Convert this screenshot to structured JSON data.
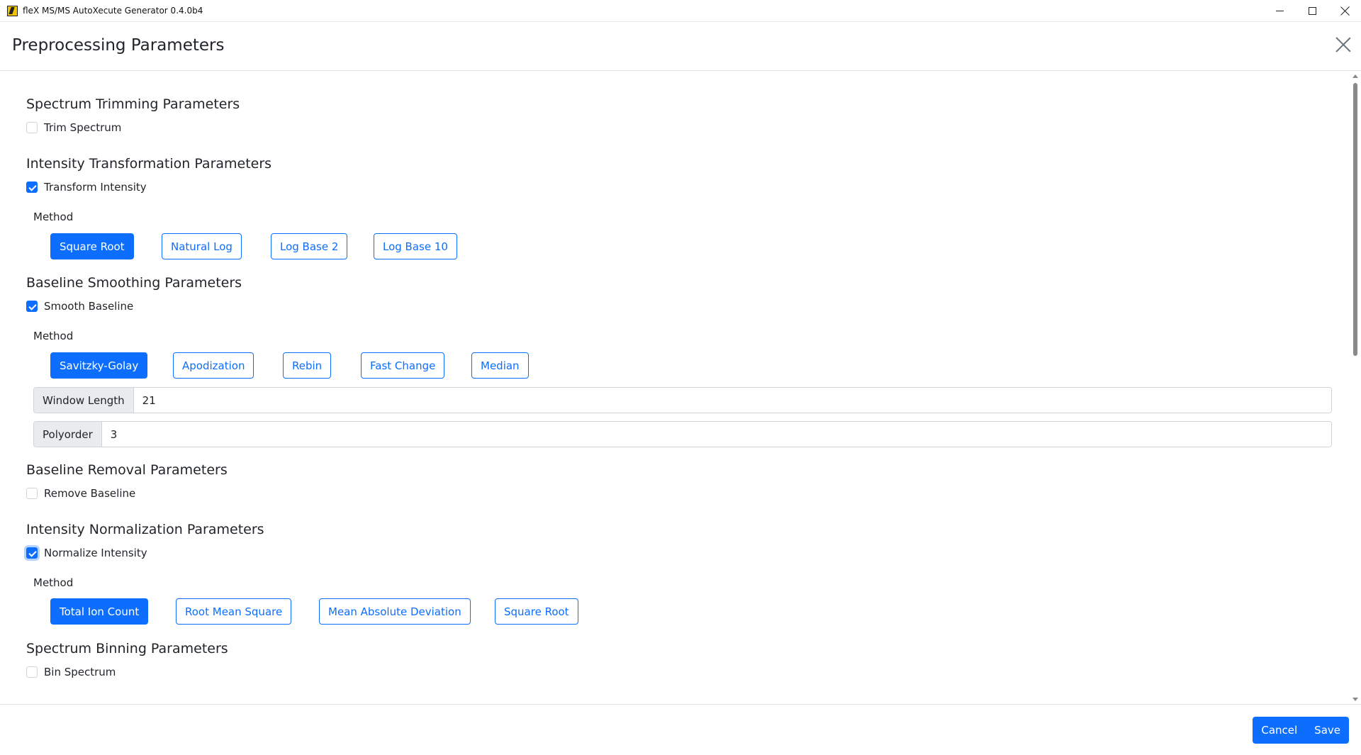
{
  "window": {
    "title": "fleX MS/MS AutoXecute Generator 0.4.0b4",
    "controls": [
      "minimize-icon",
      "maximize-icon",
      "close-icon"
    ]
  },
  "modal": {
    "title": "Preprocessing Parameters"
  },
  "sections": {
    "trimming": {
      "title": "Spectrum Trimming Parameters",
      "checkbox_label": "Trim Spectrum",
      "checked": false
    },
    "intensity": {
      "title": "Intensity Transformation Parameters",
      "checkbox_label": "Transform Intensity",
      "checked": true,
      "method_label": "Method",
      "methods": [
        "Square Root",
        "Natural Log",
        "Log Base 2",
        "Log Base 10"
      ],
      "selected": "Square Root"
    },
    "smoothing": {
      "title": "Baseline Smoothing Parameters",
      "checkbox_label": "Smooth Baseline",
      "checked": true,
      "method_label": "Method",
      "methods": [
        "Savitzky-Golay",
        "Apodization",
        "Rebin",
        "Fast Change",
        "Median"
      ],
      "selected": "Savitzky-Golay",
      "window_length_label": "Window Length",
      "window_length_value": "21",
      "polyorder_label": "Polyorder",
      "polyorder_value": "3"
    },
    "removal": {
      "title": "Baseline Removal Parameters",
      "checkbox_label": "Remove Baseline",
      "checked": false
    },
    "normalization": {
      "title": "Intensity Normalization Parameters",
      "checkbox_label": "Normalize Intensity",
      "checked": true,
      "method_label": "Method",
      "methods": [
        "Total Ion Count",
        "Root Mean Square",
        "Mean Absolute Deviation",
        "Square Root"
      ],
      "selected": "Total Ion Count"
    },
    "binning": {
      "title": "Spectrum Binning Parameters",
      "checkbox_label": "Bin Spectrum",
      "checked": false
    }
  },
  "footer": {
    "cancel_label": "Cancel",
    "save_label": "Save"
  },
  "colors": {
    "primary": "#0d6efd",
    "input_group_bg": "#e9ecef",
    "border": "#dee2e6"
  }
}
